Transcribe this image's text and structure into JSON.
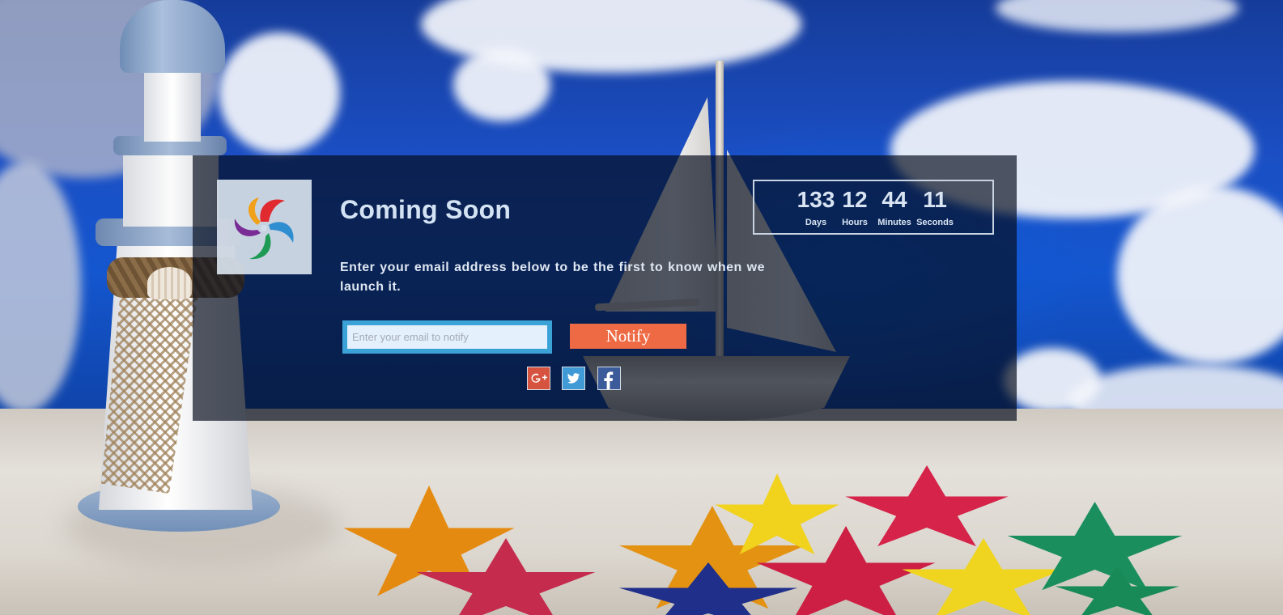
{
  "header": {
    "title": "Coming Soon",
    "subtitle": "Enter your email address below to be the first to know when we launch it."
  },
  "logo": {
    "icon": "colorful-swirl-logo-icon"
  },
  "countdown": {
    "days": {
      "value": "133",
      "label": "Days"
    },
    "hours": {
      "value": "12",
      "label": "Hours"
    },
    "minutes": {
      "value": "44",
      "label": "Minutes"
    },
    "seconds": {
      "value": "11",
      "label": "Seconds"
    }
  },
  "signup": {
    "email_placeholder": "Enter your email to notify",
    "email_value": "",
    "notify_label": "Notify"
  },
  "social": [
    {
      "name": "Google Plus",
      "icon": "google-plus-icon",
      "color": "#d6533f"
    },
    {
      "name": "Twitter",
      "icon": "twitter-icon",
      "color": "#3f9ad6"
    },
    {
      "name": "Facebook",
      "icon": "facebook-icon",
      "color": "#3b5b9a"
    }
  ],
  "colors": {
    "accent": "#ee6a44",
    "input_border": "#3aa2d7",
    "panel": "rgba(5,12,28,0.68)",
    "heading_text": "#d4e3f4"
  }
}
